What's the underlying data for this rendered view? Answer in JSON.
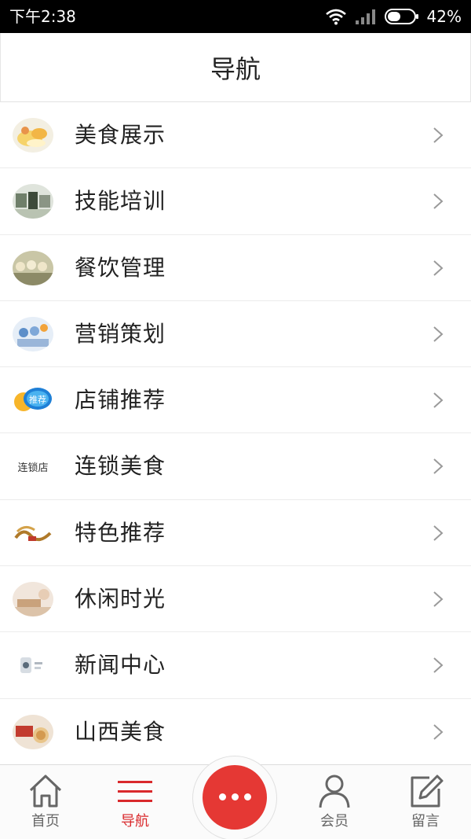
{
  "status_bar": {
    "time": "下午2:38",
    "battery": "42%"
  },
  "header": {
    "title": "导航"
  },
  "nav_items": [
    {
      "label": "美食展示",
      "icon": "food-display-thumbnail"
    },
    {
      "label": "技能培训",
      "icon": "skill-training-thumbnail"
    },
    {
      "label": "餐饮管理",
      "icon": "catering-management-thumbnail"
    },
    {
      "label": "营销策划",
      "icon": "marketing-planning-thumbnail"
    },
    {
      "label": "店铺推荐",
      "icon": "store-recommend-thumbnail"
    },
    {
      "label": "连锁美食",
      "icon": "chain-food-thumbnail"
    },
    {
      "label": "特色推荐",
      "icon": "featured-recommend-thumbnail"
    },
    {
      "label": "休闲时光",
      "icon": "leisure-time-thumbnail"
    },
    {
      "label": "新闻中心",
      "icon": "news-center-thumbnail"
    },
    {
      "label": "山西美食",
      "icon": "shanxi-food-thumbnail"
    }
  ],
  "thumb_text": {
    "store_badge": "推荐",
    "chain_text": "连锁店"
  },
  "bottom_nav": {
    "home": "首页",
    "nav": "导航",
    "member": "会员",
    "message": "留言"
  },
  "colors": {
    "accent": "#d9292c",
    "center_button": "#e53834",
    "chevron": "#9a9a9a"
  }
}
